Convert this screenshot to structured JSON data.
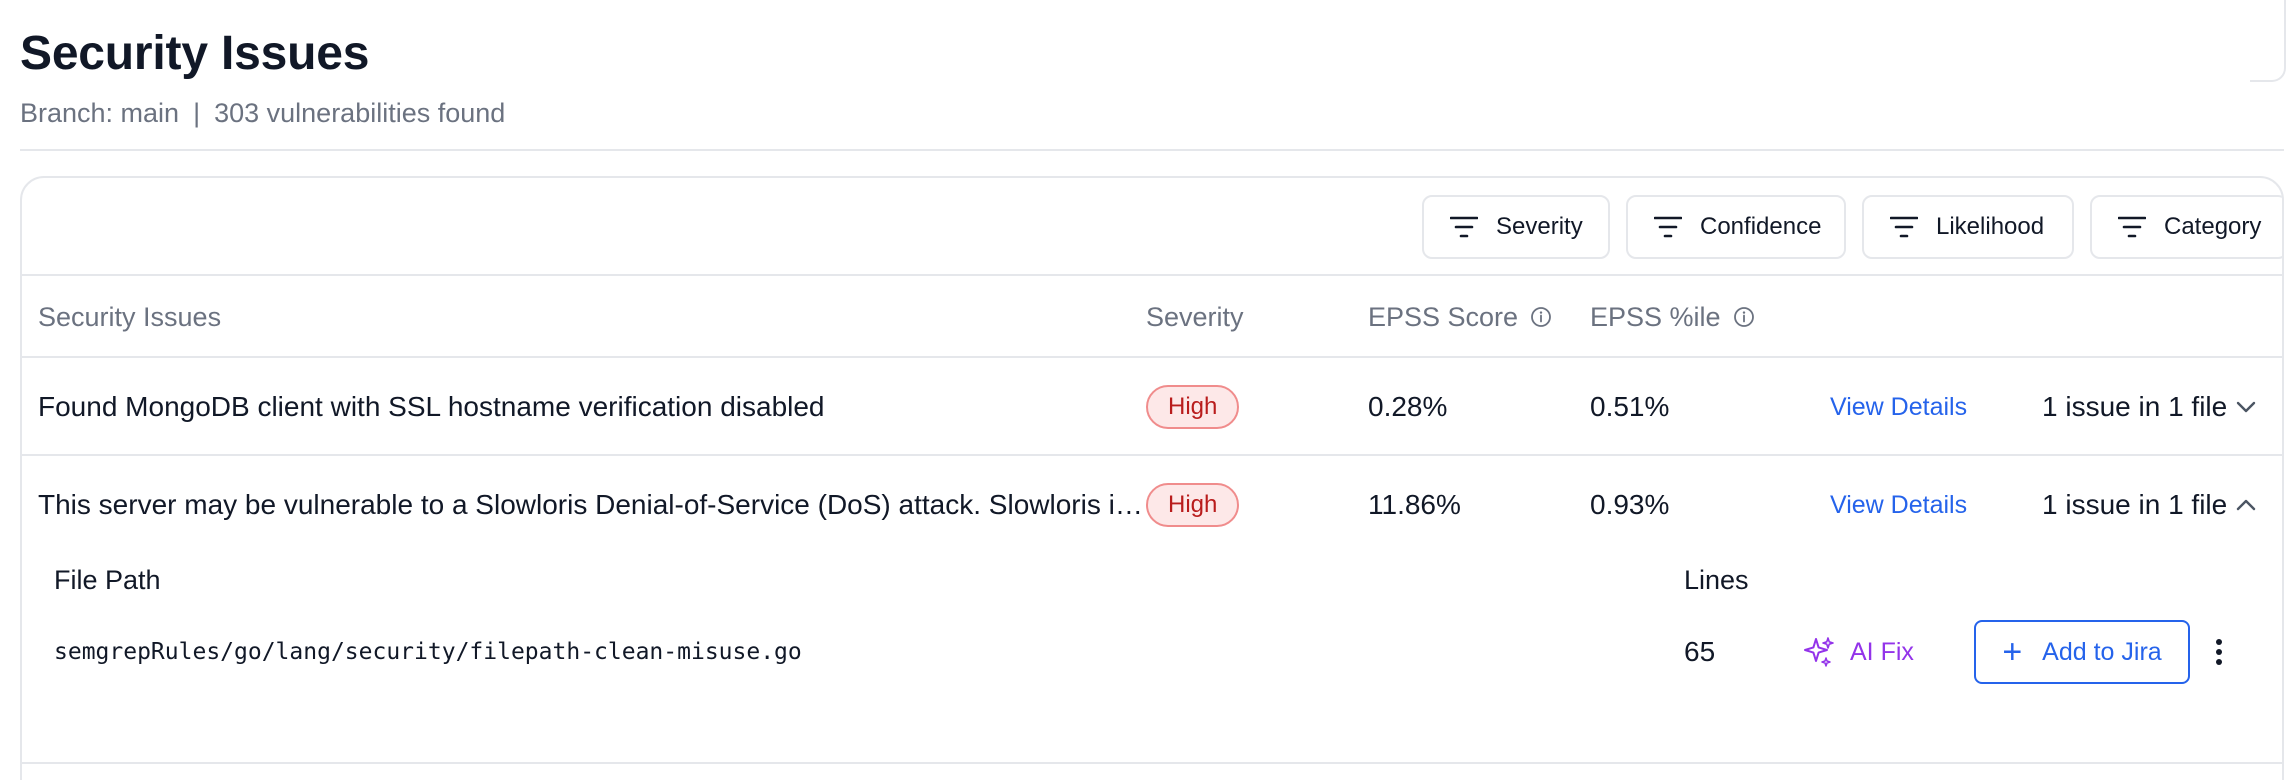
{
  "header": {
    "title": "Security Issues",
    "branch_label": "Branch: main",
    "separator": "|",
    "count_text": "303 vulnerabilities found"
  },
  "filters": [
    {
      "label": "Severity",
      "icon": "filter-lines-icon"
    },
    {
      "label": "Confidence",
      "icon": "filter-lines-icon"
    },
    {
      "label": "Likelihood",
      "icon": "filter-lines-icon"
    },
    {
      "label": "Category",
      "icon": "filter-lines-icon"
    }
  ],
  "table": {
    "columns": {
      "issue": "Security Issues",
      "severity": "Severity",
      "epss_score": "EPSS Score",
      "epss_pct": "EPSS %ile"
    },
    "rows": [
      {
        "title": "Found MongoDB client with SSL hostname verification disabled",
        "severity": "High",
        "epss_score": "0.28%",
        "epss_pct": "0.51%",
        "action": "View Details",
        "issues": "1 issue in 1 file",
        "expanded": false
      },
      {
        "title": "This server may be vulnerable to a Slowloris Denial-of-Service (DoS) attack. Slowloris is a type of DoS attack",
        "severity": "High",
        "epss_score": "11.86%",
        "epss_pct": "0.93%",
        "action": "View Details",
        "issues": "1 issue in 1 file",
        "expanded": true
      }
    ],
    "expanded_detail": {
      "file_path_header": "File Path",
      "lines_header": "Lines",
      "files": [
        {
          "path": "semgrepRules/go/lang/security/filepath-clean-misuse.go",
          "lines": "65",
          "ai_fix": "AI Fix",
          "add_to_jira": "Add to Jira"
        }
      ]
    }
  },
  "colors": {
    "link": "#2563eb",
    "ai_fix": "#9333ea",
    "badge_high_bg": "#fde8e8",
    "badge_high_text": "#b91c1c",
    "border": "#e5e7eb"
  }
}
